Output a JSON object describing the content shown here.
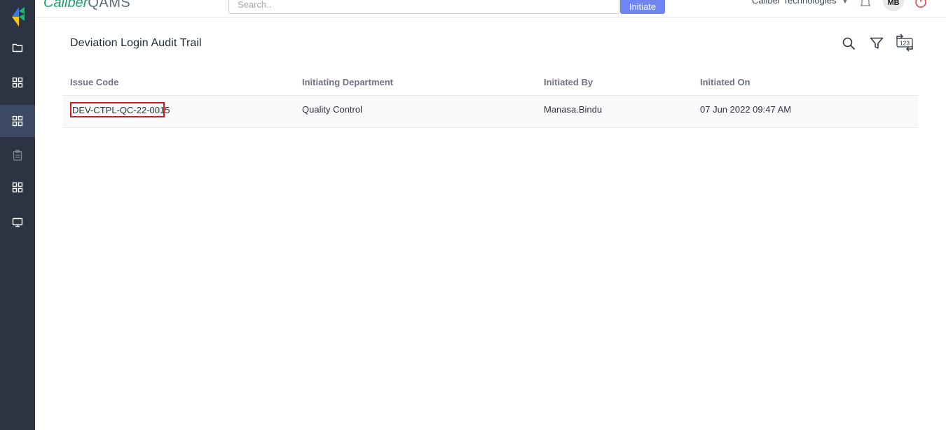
{
  "app": {
    "brand_primary": "Caliber",
    "brand_secondary": "QAMS",
    "organization": "Caliber Technologies",
    "user_initials": "MB"
  },
  "search": {
    "placeholder": "Search.."
  },
  "header": {
    "initiate_label": "Initiate"
  },
  "page": {
    "title": "Deviation Login Audit Trail"
  },
  "table": {
    "headers": [
      "Issue Code",
      "Initiating Department",
      "Initiated By",
      "Initiated On"
    ],
    "rows": [
      [
        "DEV-CTPL-QC-22-0015",
        "Quality Control",
        "Manasa.Bindu",
        "07 Jun 2022 09:47 AM"
      ]
    ]
  },
  "sidebar": {
    "items": [
      {
        "icon": "folder-icon"
      },
      {
        "icon": "grid-icon"
      },
      {
        "icon": "grid-icon",
        "active": true
      },
      {
        "icon": "clipboard-icon"
      },
      {
        "icon": "grid-icon"
      },
      {
        "icon": "monitor-icon"
      }
    ]
  },
  "toolbar": {
    "icons": [
      "search-icon",
      "filter-icon",
      "counter-icon"
    ],
    "counter_label": "123"
  },
  "colors": {
    "sidebar_bg": "#2c3444",
    "sidebar_active": "#3d4a64",
    "brand_green": "#1e9e6a",
    "initiate_button": "#6f86f2",
    "highlight_border": "#d41b1b",
    "power_icon": "#e5484d"
  }
}
